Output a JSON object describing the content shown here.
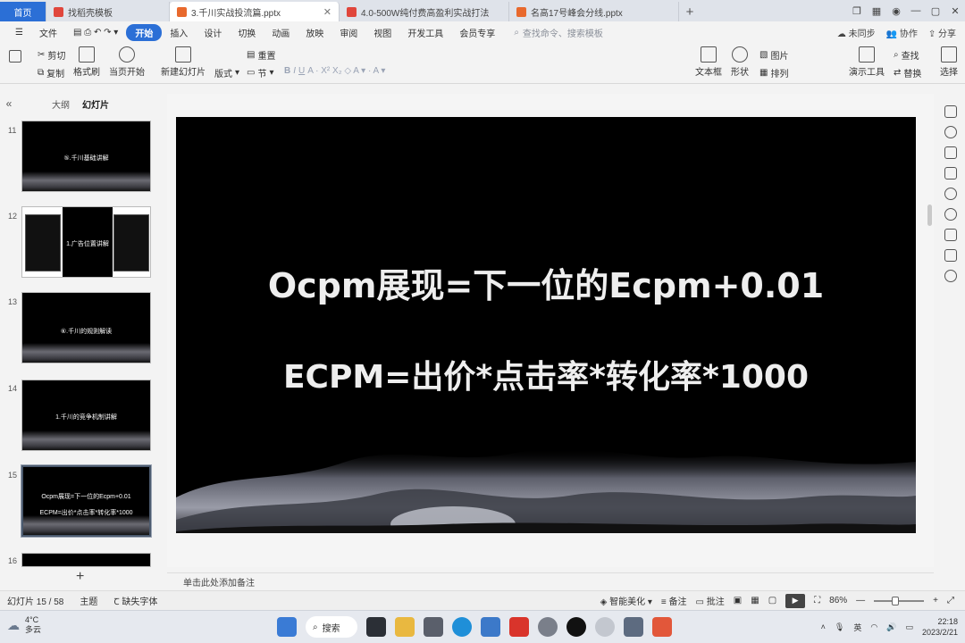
{
  "tabs": [
    {
      "label": "首页",
      "kind": "home"
    },
    {
      "label": "找稻壳模板",
      "color": "#e0463c"
    },
    {
      "label": "3.千川实战投流篇.pptx",
      "color": "#e8692d",
      "active": true
    },
    {
      "label": "4.0-500W纯付费高盈利实战打法",
      "color": "#e0463c"
    },
    {
      "label": "名高17号峰会分线.pptx",
      "color": "#e8692d"
    }
  ],
  "menu": {
    "file": "文件",
    "items": [
      "开始",
      "插入",
      "设计",
      "切换",
      "动画",
      "放映",
      "审阅",
      "视图",
      "开发工具",
      "会员专享"
    ],
    "search_placeholder": "查找命令、搜索模板",
    "sync": "未同步",
    "collab": "协作",
    "share": "分享"
  },
  "ribbon": {
    "cut": "剪切",
    "copy": "复制",
    "format_painter": "格式刷",
    "play_from_current": "当页开始",
    "new_slide": "新建幻灯片",
    "layout": "版式",
    "section": "节",
    "reset": "重置",
    "textbox": "文本框",
    "shape": "形状",
    "picture": "图片",
    "arrange": "排列",
    "find": "查找",
    "replace": "替换",
    "presenter_tools": "演示工具",
    "select": "选择"
  },
  "left_panel": {
    "outline_tab": "大纲",
    "slides_tab": "幻灯片",
    "thumbnails": [
      {
        "number": "11",
        "text": "⑤.千川基础讲解"
      },
      {
        "number": "12",
        "text": "1.广告位置讲解"
      },
      {
        "number": "13",
        "text": "⑥.千川的规则解读"
      },
      {
        "number": "14",
        "text": "1.千川的竞争机制讲解"
      },
      {
        "number": "15",
        "text_line1": "Ocpm展现=下一位的Ecpm+0.01",
        "text_line2": "ECPM=出价*点击率*转化率*1000"
      },
      {
        "number": "16",
        "text": ""
      }
    ]
  },
  "slide": {
    "line1": "Ocpm展现=下一位的Ecpm+0.01",
    "line2": "ECPM=出价*点击率*转化率*1000"
  },
  "notes_placeholder": "单击此处添加备注",
  "status": {
    "slide_counter": "幻灯片 15 / 58",
    "theme": "主题",
    "missing_fonts": "缺失字体",
    "beautify": "智能美化",
    "notes": "备注",
    "comments": "批注",
    "zoom": "86%"
  },
  "taskbar": {
    "temperature": "4°C",
    "weather": "多云",
    "search": "搜索",
    "lang": "英",
    "time": "22:18",
    "date": "2023/2/21"
  }
}
